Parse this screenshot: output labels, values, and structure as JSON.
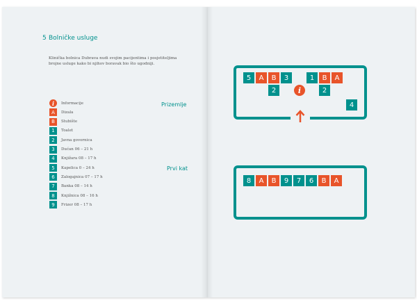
{
  "section": {
    "number": "5",
    "title": "Bolničke usluge",
    "intro": "Klinička bolnica Dubrava nudi svojim pacijentima i posjetiteljima brojne usluge kako bi njihov boravak bio što ugodniji."
  },
  "floors": {
    "ground": "Prizemlje",
    "first": "Prvi kat"
  },
  "legend": [
    {
      "badge": "i",
      "kind": "info",
      "color": "#e8542a",
      "text": "Informacije"
    },
    {
      "badge": "A",
      "kind": "square",
      "color": "#e8542a",
      "text": "Dizala"
    },
    {
      "badge": "B",
      "kind": "square",
      "color": "#e8542a",
      "text": "Stubište"
    },
    {
      "badge": "1",
      "kind": "square",
      "color": "#00918d",
      "text": "Toalet"
    },
    {
      "badge": "2",
      "kind": "square",
      "color": "#00918d",
      "text": "Javna govornica"
    },
    {
      "badge": "3",
      "kind": "square",
      "color": "#00918d",
      "text": "Dućan 06 – 21 h"
    },
    {
      "badge": "4",
      "kind": "square",
      "color": "#00918d",
      "text": "Knjižara 08 – 17 h"
    },
    {
      "badge": "5",
      "kind": "square",
      "color": "#00918d",
      "text": "Kapelica 0 – 24 h"
    },
    {
      "badge": "6",
      "kind": "square",
      "color": "#00918d",
      "text": "Zalogajnica 07 – 17 h"
    },
    {
      "badge": "7",
      "kind": "square",
      "color": "#00918d",
      "text": "Banka 08 – 14 h"
    },
    {
      "badge": "8",
      "kind": "square",
      "color": "#00918d",
      "text": "Knjižnica 08 – 16 h"
    },
    {
      "badge": "9",
      "kind": "square",
      "color": "#00918d",
      "text": "Frizer 08 – 17 h"
    }
  ],
  "ground_map": {
    "top_left_group": [
      "5",
      "A",
      "B",
      "3"
    ],
    "top_right_group": [
      "1",
      "B",
      "A"
    ],
    "second_row_left": "2",
    "info": "i",
    "second_row_right": "2",
    "corner": "4"
  },
  "first_map": {
    "row": [
      "8",
      "A",
      "B",
      "9",
      "7",
      "6",
      "B",
      "A"
    ]
  },
  "colors": {
    "teal": "#00918d",
    "orange": "#e8542a",
    "page": "#eef2f4"
  }
}
